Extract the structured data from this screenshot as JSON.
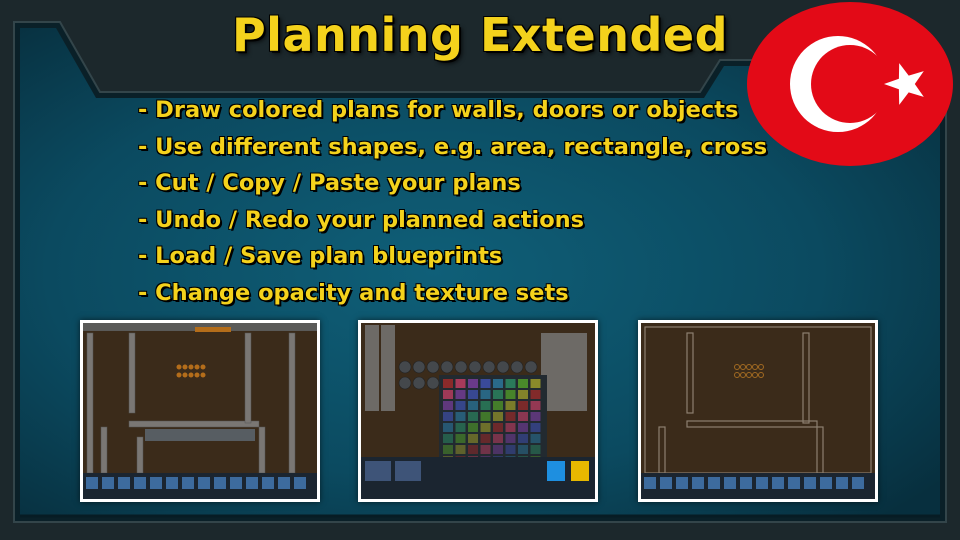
{
  "title": "Planning Extended",
  "features": [
    "- Draw colored plans for walls, doors or objects",
    "- Use different shapes, e.g. area, rectangle, cross",
    "- Cut / Copy / Paste your plans",
    "- Undo / Redo your planned actions",
    "- Load / Save plan blueprints",
    "- Change opacity and texture sets"
  ],
  "flag_icon": "turkey-flag-icon",
  "colors": {
    "title_text": "#f4d21c",
    "panel": "#0d4a60",
    "frame": "#1e2a2e",
    "flag_red": "#e30a17"
  },
  "screenshots": [
    {
      "name": "plan-walls-screenshot"
    },
    {
      "name": "plan-color-palette-screenshot"
    },
    {
      "name": "plan-opacity-screenshot"
    }
  ]
}
